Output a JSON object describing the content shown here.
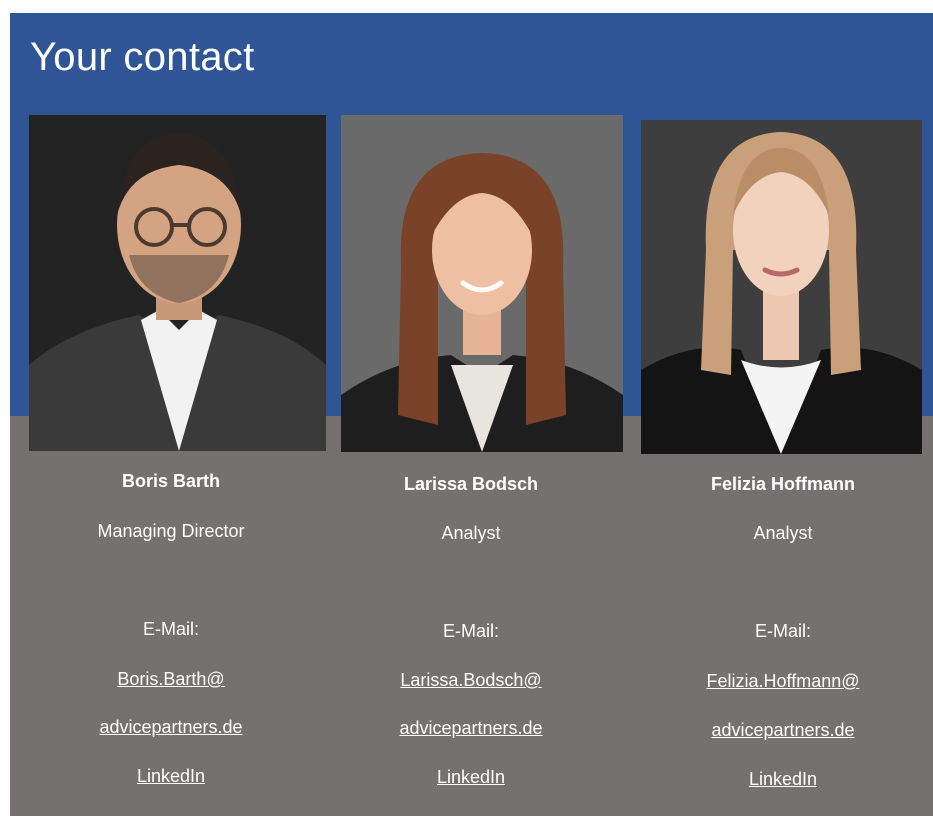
{
  "title": "Your contact",
  "colors": {
    "header_blue": "#2f5597",
    "footer_gray": "#767171",
    "text": "#ffffff"
  },
  "contacts": [
    {
      "name": "Boris Barth",
      "role": "Managing Director",
      "email_label": "E-Mail:",
      "email_line1": "Boris.Barth@",
      "email_line2": "advicepartners.de",
      "linkedin": "LinkedIn"
    },
    {
      "name": "Larissa Bodsch",
      "role": "Analyst",
      "email_label": "E-Mail:",
      "email_line1": "Larissa.Bodsch@",
      "email_line2": "advicepartners.de",
      "linkedin": "LinkedIn"
    },
    {
      "name": "Felizia Hoffmann",
      "role": "Analyst",
      "email_label": "E-Mail:",
      "email_line1": "Felizia.Hoffmann@",
      "email_line2": "advicepartners.de",
      "linkedin": "LinkedIn"
    }
  ]
}
